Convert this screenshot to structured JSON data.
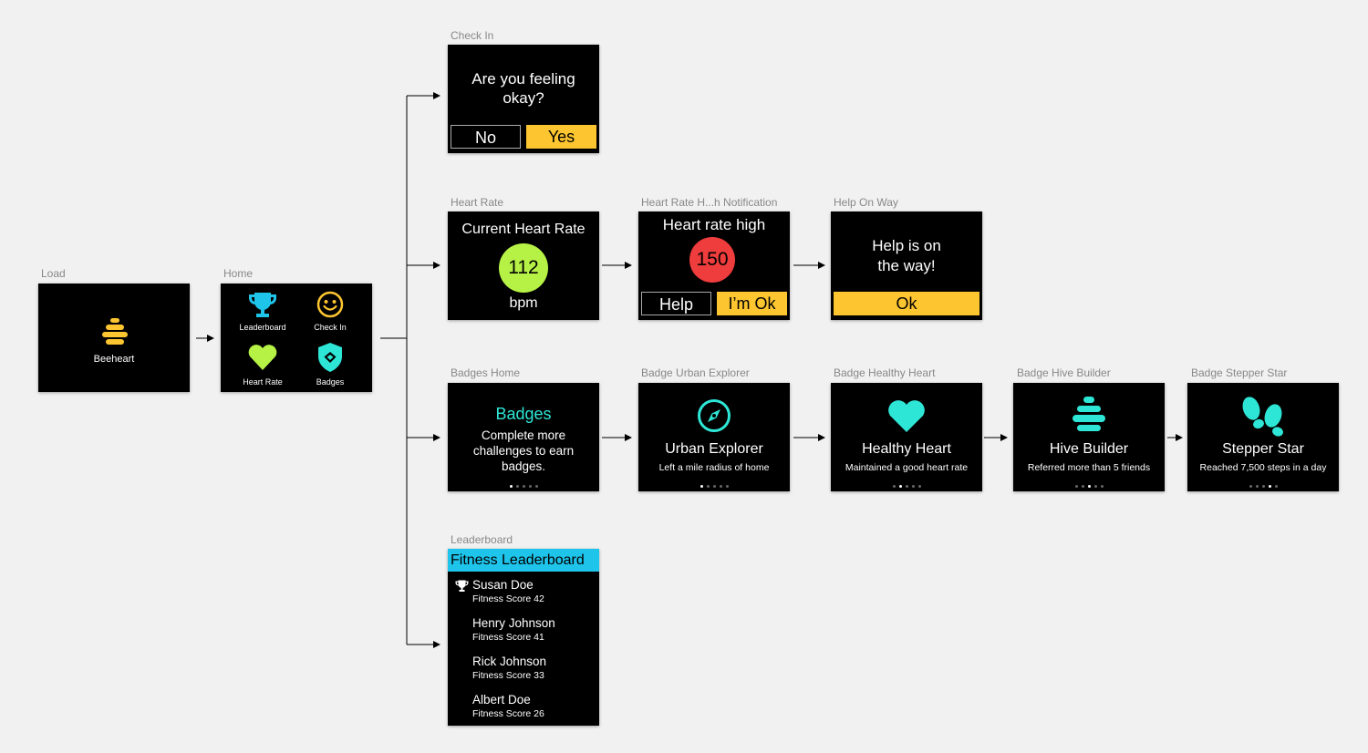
{
  "colors": {
    "yellow": "#fdc530",
    "cyan": "#2ee6d6",
    "lightblue": "#1ec4ea",
    "green": "#b6f246",
    "red": "#ef3c3c"
  },
  "labels": {
    "load": "Load",
    "home": "Home",
    "check_in": "Check In",
    "heart_rate": "Heart Rate",
    "heart_rate_notification": "Heart Rate H...h Notification",
    "help_on_way": "Help On Way",
    "badges_home": "Badges Home",
    "badge_urban_explorer": "Badge Urban Explorer",
    "badge_healthy_heart": "Badge Healthy Heart",
    "badge_hive_builder": "Badge Hive Builder",
    "badge_stepper_star": "Badge Stepper Star",
    "leaderboard": "Leaderboard"
  },
  "load": {
    "app_name": "Beeheart",
    "icon": "beehive-icon"
  },
  "home": {
    "items": [
      {
        "label": "Leaderboard",
        "icon": "trophy-icon"
      },
      {
        "label": "Check In",
        "icon": "smiley-icon"
      },
      {
        "label": "Heart Rate",
        "icon": "heart-icon"
      },
      {
        "label": "Badges",
        "icon": "shield-icon"
      }
    ]
  },
  "checkin": {
    "line1": "Are you feeling",
    "line2": "okay?",
    "no": "No",
    "yes": "Yes"
  },
  "heartrate": {
    "title": "Current Heart Rate",
    "value": "112",
    "unit": "bpm"
  },
  "notification": {
    "title": "Heart rate high",
    "value": "150",
    "help": "Help",
    "ok": "I’m Ok"
  },
  "helpway": {
    "line1": "Help is on",
    "line2": "the way!",
    "ok": "Ok"
  },
  "badges_home": {
    "title": "Badges",
    "line1": "Complete more",
    "line2": "challenges to earn",
    "line3": "badges."
  },
  "badges": [
    {
      "title": "Urban Explorer",
      "desc": "Left a mile radius of home",
      "icon": "compass-icon",
      "active_dot": 0
    },
    {
      "title": "Healthy Heart",
      "desc": "Maintained a good heart rate",
      "icon": "heart-icon",
      "active_dot": 1
    },
    {
      "title": "Hive Builder",
      "desc": "Referred more than 5 friends",
      "icon": "beehive-icon",
      "active_dot": 2
    },
    {
      "title": "Stepper Star",
      "desc": "Reached 7,500 steps in a day",
      "icon": "footprints-icon",
      "active_dot": 3
    }
  ],
  "leaderboard": {
    "title": "Fitness Leaderboard",
    "rows": [
      {
        "name": "Susan Doe",
        "score": "Fitness Score 42",
        "icon": "trophy-icon"
      },
      {
        "name": "Henry Johnson",
        "score": "Fitness Score 41"
      },
      {
        "name": "Rick Johnson",
        "score": "Fitness Score 33"
      },
      {
        "name": "Albert Doe",
        "score": "Fitness Score 26"
      }
    ]
  }
}
